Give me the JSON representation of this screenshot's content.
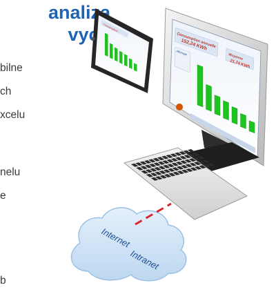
{
  "heading": {
    "line1": "analiza",
    "line2": "vych"
  },
  "body_fragments": [
    "bilne",
    "ch",
    "xcelu",
    "nelu",
    "e",
    "b"
  ],
  "cloud": {
    "label1": "Internet",
    "label2": "Intranet"
  },
  "tablet_screen": {
    "title": "Consumption",
    "values": [
      0.95,
      0.62,
      0.55,
      0.5,
      0.48,
      0.4,
      0.3
    ]
  },
  "monitor_screen": {
    "title": "Consumption annuelle",
    "value": "152,24 KWh",
    "side_label": "Moyenne",
    "side_value": "21,74 KWh",
    "left_label": "Affichage",
    "values": [
      0.97,
      0.6,
      0.45,
      0.42,
      0.38,
      0.32,
      0.25
    ]
  },
  "colors": {
    "heading": "#1f63b4",
    "bars": "#1fc31f",
    "link": "#d8242b",
    "cloud_fill": "#cfe3f6",
    "cloud_stroke": "#9dc1e6"
  }
}
